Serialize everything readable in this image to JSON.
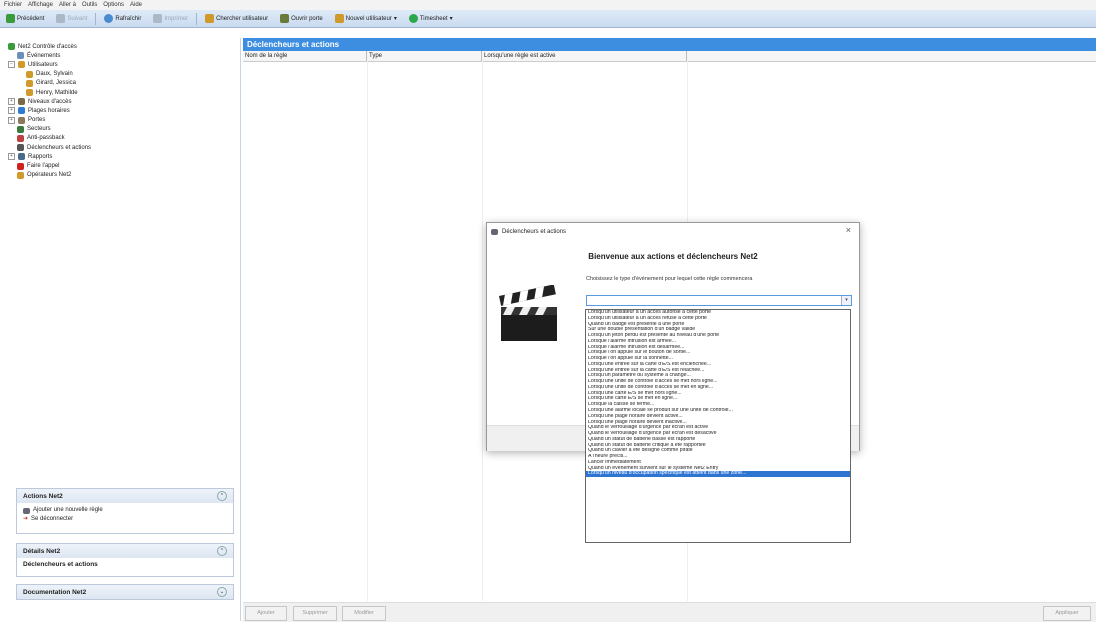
{
  "menubar": [
    "Fichier",
    "Affichage",
    "Aller à",
    "Outils",
    "Options",
    "Aide"
  ],
  "toolbar": {
    "precedent": "Précédent",
    "suivant": "Suivant",
    "rafraichir": "Rafraîchir",
    "imprimer": "Imprimer",
    "chercher": "Chercher utilisateur",
    "ouvrir": "Ouvrir porte",
    "nouvel": "Nouvel utilisateur",
    "timesheet": "Timesheet"
  },
  "tree": [
    {
      "label": "Net2 Contrôle d'accès",
      "level": 0,
      "exp": "",
      "color": "#3a9b3a"
    },
    {
      "label": "Événements",
      "level": 1,
      "exp": "",
      "color": "#6b8fb8"
    },
    {
      "label": "Utilisateurs",
      "level": 0,
      "exp": "−",
      "color": "#d09a2a"
    },
    {
      "label": "Daux, Sylvain",
      "level": 2,
      "exp": "",
      "color": "#d09a2a"
    },
    {
      "label": "Girard, Jessica",
      "level": 2,
      "exp": "",
      "color": "#d09a2a"
    },
    {
      "label": "Henry, Mathilde",
      "level": 2,
      "exp": "",
      "color": "#d09a2a"
    },
    {
      "label": "Niveaux d'accès",
      "level": 0,
      "exp": "+",
      "color": "#7a6a4a"
    },
    {
      "label": "Plages horaires",
      "level": 0,
      "exp": "+",
      "color": "#2d7bd2"
    },
    {
      "label": "Portes",
      "level": 0,
      "exp": "+",
      "color": "#8a7a5a"
    },
    {
      "label": "Secteurs",
      "level": 1,
      "exp": "",
      "color": "#3a7a3a"
    },
    {
      "label": "Anti-passback",
      "level": 1,
      "exp": "",
      "color": "#c04040"
    },
    {
      "label": "Déclencheurs et actions",
      "level": 1,
      "exp": "",
      "color": "#555555"
    },
    {
      "label": "Rapports",
      "level": 0,
      "exp": "+",
      "color": "#4a6a8a"
    },
    {
      "label": "Faire l'appel",
      "level": 1,
      "exp": "",
      "color": "#d02020"
    },
    {
      "label": "Opérateurs Net2",
      "level": 1,
      "exp": "",
      "color": "#d09a2a"
    }
  ],
  "panels": {
    "actions": {
      "title": "Actions Net2",
      "items": [
        "Ajouter une nouvelle règle",
        "Se déconnecter"
      ]
    },
    "details": {
      "title": "Détails Net2",
      "content": "Déclencheurs et actions"
    },
    "doc": {
      "title": "Documentation Net2"
    }
  },
  "main": {
    "title": "Déclencheurs et actions",
    "columns": [
      "Nom de la règle",
      "Type",
      "Lorsqu'une règle est active"
    ],
    "buttons": {
      "ajouter": "Ajouter",
      "supprimer": "Supprimer",
      "modifier": "Modifier",
      "appliquer": "Appliquer"
    }
  },
  "dialog": {
    "title": "Déclencheurs et actions",
    "heading": "Bienvenue aux actions et déclencheurs Net2",
    "prompt": "Choisissez le type d'événement pour lequel cette règle commencera",
    "close": "×",
    "options": [
      "Lorsqu'un utilisateur a un accès autorisé à cette porte",
      "Lorsqu'un utilisateur a un accès refusé à cette porte",
      "Quand un badge est présenté à une porte",
      "Sur une double présentation d'un badge valide",
      "Lorsqu'un jeton perdu est présenté au niveau d'une porte",
      "Lorsque l'alarme intrusion est armée...",
      "Lorsque l'alarme intrusion est désarmée...",
      "Lorsque l'on appuie sur le bouton de sortie...",
      "Lorsque l'on appuie sur la sonnette...",
      "Lorsqu'une entrée sur la carte d'E/S est enclenchée...",
      "Lorsqu'une entrée sur la carte d'E/S est relâchée...",
      "Lorsqu'un paramètre du système a changé...",
      "Lorsqu'une unité de contrôle d'accès se met hors ligne...",
      "Lorsqu'une unité de contrôle d'accès se met en ligne...",
      "Lorsqu'une carte E/S se met hors ligne...",
      "Lorsqu'une carte E/S se met en ligne...",
      "Lorsque la caisse se ferme...",
      "Lorsqu'une alarme locale se produit sur une unité de contrôle...",
      "Lorsqu'une plage horaire devient active...",
      "Lorsqu'une plage horaire devient inactive...",
      "Quand le verrouillage d'urgence par écran est activé",
      "Quand le verrouillage d'urgence par écran est désactivé",
      "Quand un statut de batterie basse est rapporté",
      "Quand un statut de batterie critique a été rapportée",
      "Quand un clavier a été désigné comme piraté",
      "A l'heure précis...",
      "Lancer immédiatement",
      "Quand un événement survient sur le système Net2 Entry",
      "Lorsqu'un niveau d'occupation spécifique est atteint dans une zone..."
    ]
  }
}
